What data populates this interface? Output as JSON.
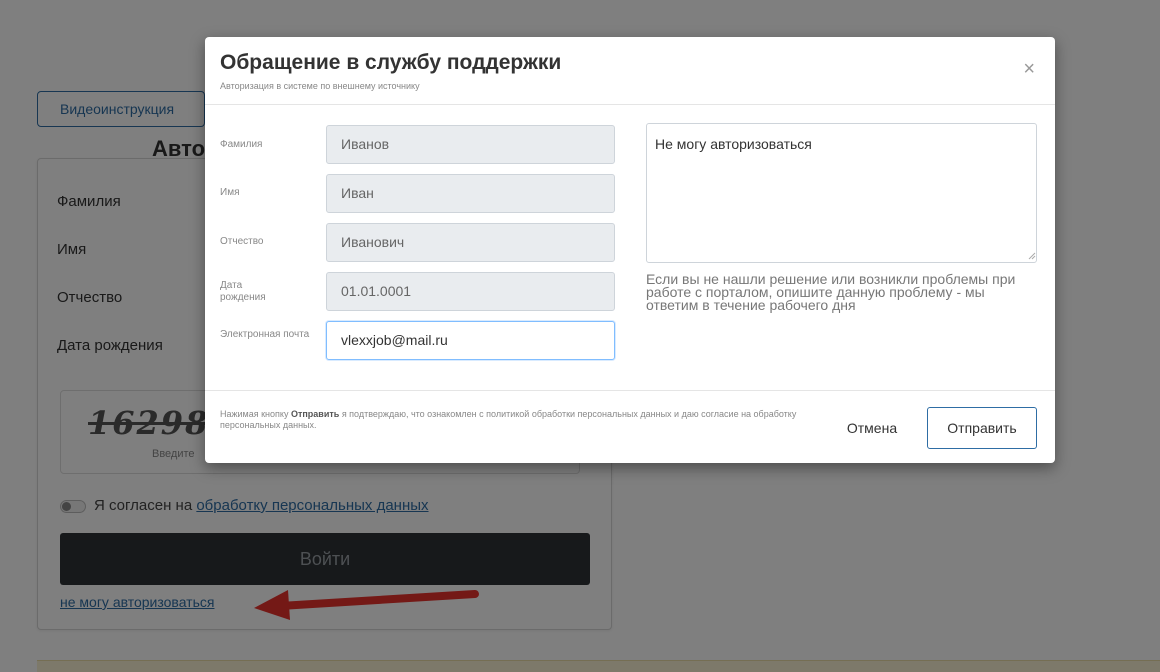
{
  "background_page": {
    "video_button_label": "Видеоинструкция",
    "auth_title": "Авто",
    "fields": {
      "surname": "Фамилия",
      "name": "Имя",
      "patronymic": "Отчество",
      "birthdate": "Дата рождения"
    },
    "captcha_text": "16298",
    "captcha_caption": "Введите",
    "consent_prefix": "Я согласен на ",
    "consent_link": "обработку персональных данных",
    "login_button": "Войти",
    "cant_login_link": "не могу авторизоваться",
    "colors": {
      "link": "#2e6da4",
      "login_button_bg": "#2f3237",
      "arrow": "#e8322c"
    }
  },
  "modal": {
    "title": "Обращение в службу поддержки",
    "subtitle": "Авторизация в системе по внешнему источнику",
    "close_symbol": "×",
    "fields": [
      {
        "label": "Фамилия",
        "value": "Иванов",
        "editable": false
      },
      {
        "label": "Имя",
        "value": "Иван",
        "editable": false
      },
      {
        "label": "Отчество",
        "value": "Иванович",
        "editable": false
      },
      {
        "label": "Дата рождения",
        "value": "01.01.0001",
        "editable": false
      },
      {
        "label": "Электронная почта",
        "value": "vlexxjob@mail.ru",
        "editable": true
      }
    ],
    "message": "Не могу авторизоваться",
    "help_text": "Если вы не нашли решение или возникли проблемы при работе с порталом, опишите данную проблему - мы ответим в течение рабочего дня",
    "footer": {
      "note_prefix": "Нажимая кнопку ",
      "note_bold": "Отправить",
      "note_suffix": " я подтверждаю, что ознакомлен с политикой обработки персональных данных и даю согласие на обработку персональных данных.",
      "cancel_label": "Отмена",
      "send_label": "Отправить"
    }
  }
}
